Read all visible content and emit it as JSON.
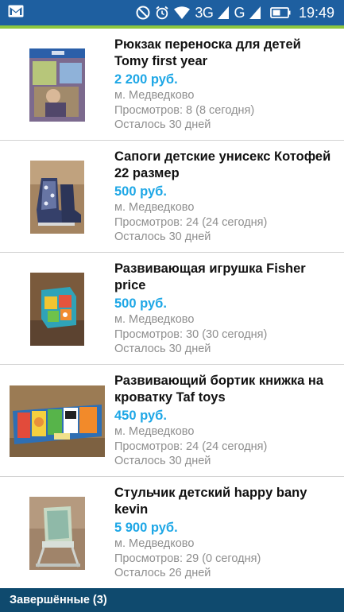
{
  "status_bar": {
    "network": "3G",
    "network2": "G",
    "time": "19:49",
    "icons": [
      "gmail-icon",
      "do-not-disturb-icon",
      "alarm-icon",
      "wifi-icon",
      "signal-icon",
      "battery-icon"
    ]
  },
  "listings": [
    {
      "title": "Рюкзак переноска для детей Tomy first year",
      "price": "2 200 руб.",
      "metro": "м. Медведково",
      "views": "Просмотров: 8 (8 сегодня)",
      "remaining": "Осталось 30 дней"
    },
    {
      "title": "Сапоги детские унисекс Котофей 22 размер",
      "price": "500 руб.",
      "metro": "м. Медведково",
      "views": "Просмотров: 24 (24 сегодня)",
      "remaining": "Осталось 30 дней"
    },
    {
      "title": "Развивающая игрушка Fisher price",
      "price": "500 руб.",
      "metro": "м. Медведково",
      "views": "Просмотров: 30 (30 сегодня)",
      "remaining": "Осталось 30 дней"
    },
    {
      "title": "Развивающий бортик книжка на кроватку Taf toys",
      "price": "450 руб.",
      "metro": "м. Медведково",
      "views": "Просмотров: 24 (24 сегодня)",
      "remaining": "Осталось 30 дней"
    },
    {
      "title": "Стульчик детский happy bany kevin",
      "price": "5 900 руб.",
      "metro": "м. Медведково",
      "views": "Просмотров: 29 (0 сегодня)",
      "remaining": "Осталось 26 дней"
    }
  ],
  "bottom_bar": {
    "label": "Завершённые (3)"
  },
  "colors": {
    "status_bar": "#1e5fa0",
    "accent": "#8cc63f",
    "price": "#1ea7e6",
    "bottom_bar": "#0f4a6e"
  }
}
